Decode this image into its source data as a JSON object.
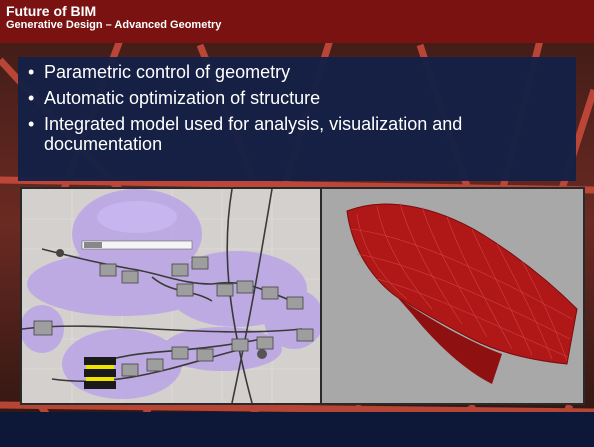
{
  "slide": {
    "title": "Future of BIM",
    "subtitle": "Generative Design – Advanced Geometry",
    "bullets": [
      "Parametric control of geometry",
      "Automatic optimization of structure",
      "Integrated model used for analysis, visualization and documentation"
    ]
  },
  "icons": {
    "grasshopper": "node-graph-canvas",
    "rhino": "3d-mesh-viewport"
  },
  "colors": {
    "title_bar": "#7a1212",
    "bullet_box": "#142046",
    "structure_red": "#b01818"
  }
}
